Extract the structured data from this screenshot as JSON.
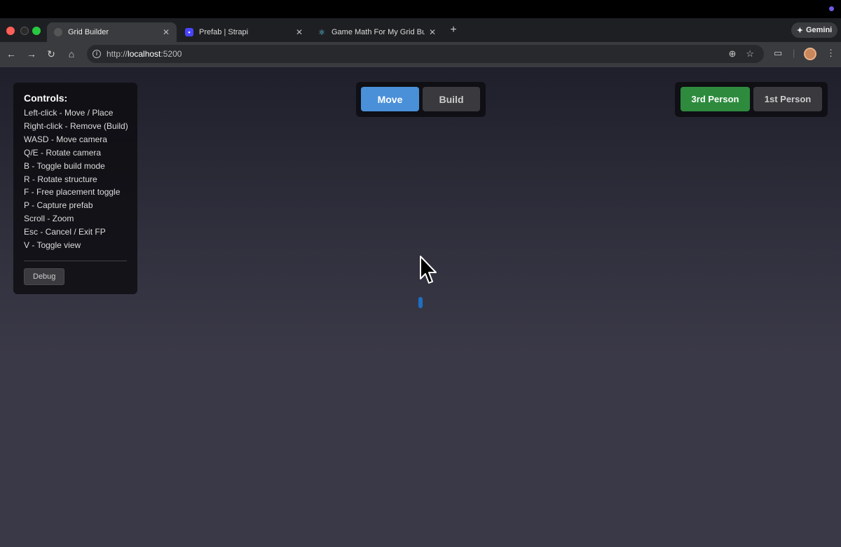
{
  "browser": {
    "tabs": [
      {
        "label": "Grid Builder",
        "active": true
      },
      {
        "label": "Prefab | Strapi",
        "active": false
      },
      {
        "label": "Game Math For My Grid Build",
        "active": false
      }
    ],
    "url_prefix": "http://",
    "url_host": "localhost",
    "url_suffix": ":5200",
    "gemini_label": "Gemini"
  },
  "controls": {
    "title": "Controls:",
    "lines": [
      "Left-click - Move / Place",
      "Right-click - Remove (Build)",
      "WASD - Move camera",
      "Q/E - Rotate camera",
      "B - Toggle build mode",
      "R - Rotate structure",
      "F - Free placement toggle",
      "P - Capture prefab",
      "Scroll - Zoom",
      "Esc - Cancel / Exit FP",
      "V - Toggle view"
    ],
    "debug_label": "Debug"
  },
  "mode": {
    "move_label": "Move",
    "build_label": "Build",
    "active": "Move"
  },
  "view": {
    "third_label": "3rd Person",
    "first_label": "1st Person",
    "active": "3rd Person"
  },
  "colors": {
    "move_active": "#4a90d9",
    "build_inactive": "#3a3a3e",
    "third_active": "#2e8b3e",
    "first_inactive": "#3a3a3e",
    "grid_light": "#4a4858",
    "grid_dark": "#3a3947"
  }
}
